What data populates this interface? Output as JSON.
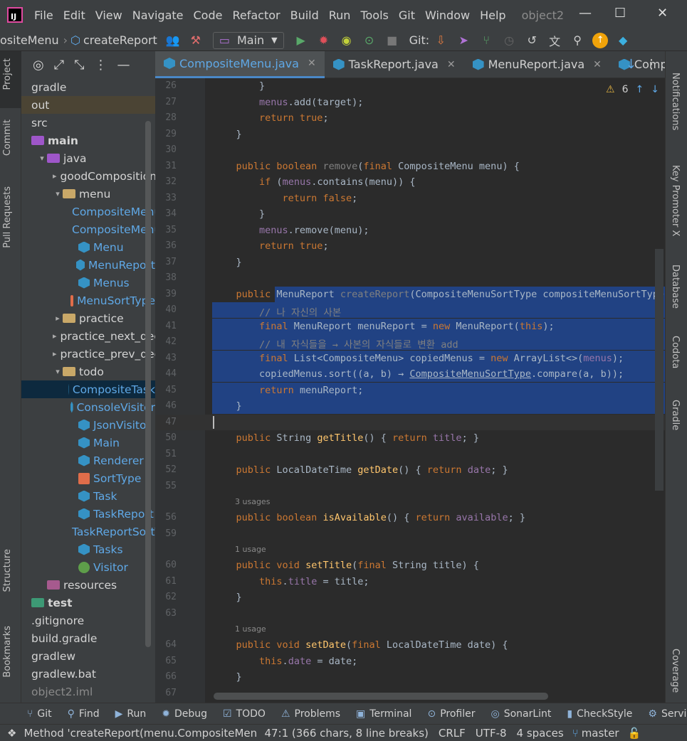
{
  "menubar": {
    "items": [
      "File",
      "Edit",
      "View",
      "Navigate",
      "Code",
      "Refactor",
      "Build",
      "Run",
      "Tools",
      "Git",
      "Window",
      "Help"
    ],
    "project": "object2"
  },
  "toolbar": {
    "breadcrumb_class": "ositeMenu",
    "breadcrumb_method": "createReport",
    "branch": "Main",
    "git_label": "Git:"
  },
  "left_strip": {
    "project": "Project",
    "commit": "Commit",
    "pull_requests": "Pull Requests",
    "structure": "Structure",
    "bookmarks": "Bookmarks"
  },
  "right_strip": {
    "notifications": "Notifications",
    "key_promoter": "Key Promoter X",
    "database": "Database",
    "codota": "Codota",
    "gradle": "Gradle",
    "coverage": "Coverage"
  },
  "project_tree": [
    {
      "label": "gradle",
      "indent": 0,
      "icon": "none",
      "arrow": ""
    },
    {
      "label": "out",
      "indent": 0,
      "icon": "none",
      "arrow": "",
      "state": "hl"
    },
    {
      "label": "src",
      "indent": 0,
      "icon": "none",
      "arrow": ""
    },
    {
      "label": "main",
      "indent": 0,
      "icon": "folder-src",
      "arrow": "",
      "bold": true
    },
    {
      "label": "java",
      "indent": 1,
      "icon": "folder-src",
      "arrow": "▾"
    },
    {
      "label": "goodComposition",
      "indent": 2,
      "icon": "folder",
      "arrow": "▸"
    },
    {
      "label": "menu",
      "indent": 2,
      "icon": "folder",
      "arrow": "▾"
    },
    {
      "label": "CompositeMenu",
      "indent": 3,
      "icon": "class",
      "arrow": "",
      "color": "#5fa8e6"
    },
    {
      "label": "CompositeMenuSortType",
      "indent": 3,
      "icon": "enum",
      "arrow": "",
      "color": "#5fa8e6"
    },
    {
      "label": "Menu",
      "indent": 3,
      "icon": "class",
      "arrow": "",
      "color": "#5fa8e6"
    },
    {
      "label": "MenuReport",
      "indent": 3,
      "icon": "class",
      "arrow": "",
      "color": "#5fa8e6"
    },
    {
      "label": "Menus",
      "indent": 3,
      "icon": "class",
      "arrow": "",
      "color": "#5fa8e6"
    },
    {
      "label": "MenuSortType",
      "indent": 3,
      "icon": "enum",
      "arrow": "",
      "color": "#5fa8e6"
    },
    {
      "label": "practice",
      "indent": 2,
      "icon": "folder",
      "arrow": "▸"
    },
    {
      "label": "practice_next_decorator",
      "indent": 2,
      "icon": "folder",
      "arrow": "▸"
    },
    {
      "label": "practice_prev_decorator",
      "indent": 2,
      "icon": "folder",
      "arrow": "▸"
    },
    {
      "label": "todo",
      "indent": 2,
      "icon": "folder",
      "arrow": "▾"
    },
    {
      "label": "CompositeTask",
      "indent": 3,
      "icon": "class",
      "arrow": "",
      "color": "#5fa8e6",
      "state": "sel"
    },
    {
      "label": "ConsoleVisitor",
      "indent": 3,
      "icon": "class",
      "arrow": "",
      "color": "#5fa8e6"
    },
    {
      "label": "JsonVisitor",
      "indent": 3,
      "icon": "class",
      "arrow": "",
      "color": "#5fa8e6"
    },
    {
      "label": "Main",
      "indent": 3,
      "icon": "class",
      "arrow": "",
      "color": "#5fa8e6"
    },
    {
      "label": "Renderer",
      "indent": 3,
      "icon": "class",
      "arrow": "",
      "color": "#5fa8e6"
    },
    {
      "label": "SortType",
      "indent": 3,
      "icon": "enum",
      "arrow": "",
      "color": "#5fa8e6"
    },
    {
      "label": "Task",
      "indent": 3,
      "icon": "class",
      "arrow": "",
      "color": "#5fa8e6"
    },
    {
      "label": "TaskReport",
      "indent": 3,
      "icon": "class",
      "arrow": "",
      "color": "#5fa8e6"
    },
    {
      "label": "TaskReportSortType",
      "indent": 3,
      "icon": "enum",
      "arrow": "",
      "color": "#5fa8e6"
    },
    {
      "label": "Tasks",
      "indent": 3,
      "icon": "class",
      "arrow": "",
      "color": "#5fa8e6"
    },
    {
      "label": "Visitor",
      "indent": 3,
      "icon": "interface",
      "arrow": "",
      "color": "#5fa8e6"
    },
    {
      "label": "resources",
      "indent": 1,
      "icon": "folder-res",
      "arrow": ""
    },
    {
      "label": "test",
      "indent": 0,
      "icon": "folder-test",
      "arrow": "",
      "bold": true
    },
    {
      "label": ".gitignore",
      "indent": 0,
      "icon": "none",
      "arrow": ""
    },
    {
      "label": "build.gradle",
      "indent": 0,
      "icon": "none",
      "arrow": ""
    },
    {
      "label": "gradlew",
      "indent": 0,
      "icon": "none",
      "arrow": ""
    },
    {
      "label": "gradlew.bat",
      "indent": 0,
      "icon": "none",
      "arrow": ""
    },
    {
      "label": "object2.iml",
      "indent": 0,
      "icon": "none",
      "arrow": "",
      "color": "#8a8a8a"
    }
  ],
  "tabs": [
    {
      "label": "CompositeMenu.java",
      "active": true
    },
    {
      "label": "TaskReport.java",
      "active": false
    },
    {
      "label": "MenuReport.java",
      "active": false
    },
    {
      "label": "Composi",
      "active": false
    }
  ],
  "warnings": "6",
  "code_lines": [
    {
      "n": "26",
      "html": "        }"
    },
    {
      "n": "27",
      "html": "        <span class=\"fld\">menus</span>.add(target);"
    },
    {
      "n": "28",
      "html": "        <span class=\"kw\">return true</span>;"
    },
    {
      "n": "29",
      "html": "    }"
    },
    {
      "n": "30",
      "html": ""
    },
    {
      "n": "31",
      "html": "    <span class=\"kw\">public boolean</span> <span class=\"gray\">remove</span>(<span class=\"kw\">final</span> CompositeMenu menu) {"
    },
    {
      "n": "32",
      "html": "        <span class=\"kw\">if</span> (<span class=\"fld\">menus</span>.contains(menu)) {"
    },
    {
      "n": "33",
      "html": "            <span class=\"kw\">return false</span>;"
    },
    {
      "n": "34",
      "html": "        }"
    },
    {
      "n": "35",
      "html": "        <span class=\"fld\">menus</span>.remove(menu);"
    },
    {
      "n": "36",
      "html": "        <span class=\"kw\">return true</span>;"
    },
    {
      "n": "37",
      "html": "    }"
    },
    {
      "n": "38",
      "html": ""
    },
    {
      "n": "39",
      "html": "    <span class=\"kw\">public</span> MenuReport <span class=\"gray\">createReport</span>(CompositeMenuSortType compositeMenuSortType) {",
      "sel": "partial"
    },
    {
      "n": "40",
      "html": "        <span class=\"cmt\">// 나 자신의 사본</span>",
      "sel": "full"
    },
    {
      "n": "41",
      "html": "        <span class=\"kw\">final</span> MenuReport menuReport = <span class=\"kw\">new</span> MenuReport(<span class=\"kw\">this</span>);",
      "sel": "full"
    },
    {
      "n": "42",
      "html": "        <span class=\"cmt\">// 내 자식들을 → 사본의 자식들로 변환 add</span>",
      "sel": "full"
    },
    {
      "n": "43",
      "html": "        <span class=\"kw\">final</span> List&lt;CompositeMenu&gt; copiedMenus = <span class=\"kw\">new</span> ArrayList&lt;&gt;(<span class=\"fld\">menus</span>);",
      "sel": "full"
    },
    {
      "n": "44",
      "html": "        copiedMenus.sort((a, b) → <u>CompositeMenuSortType</u>.compare(a, b));",
      "sel": "full"
    },
    {
      "n": "45",
      "html": "        <span class=\"kw\">return</span> menuReport;",
      "sel": "full"
    },
    {
      "n": "46",
      "html": "    }",
      "sel": "full"
    },
    {
      "n": "47",
      "html": "",
      "cursor": true
    },
    {
      "n": "50",
      "html": "    <span class=\"kw\">public</span> String <span class=\"fn\">getTitle</span>() { <span class=\"kw\">return</span> <span class=\"fld\">title</span>; }"
    },
    {
      "n": "51",
      "html": ""
    },
    {
      "n": "52",
      "html": "    <span class=\"kw\">public</span> LocalDateTime <span class=\"fn\">getDate</span>() { <span class=\"kw\">return</span> <span class=\"fld\">date</span>; }"
    },
    {
      "n": "55",
      "html": ""
    },
    {
      "n": "56",
      "html": "    <span class=\"kw\">public boolean</span> <span class=\"fn\">isAvailable</span>() { <span class=\"kw\">return</span> <span class=\"fld\">available</span>; }",
      "usage": "3 usages"
    },
    {
      "n": "59",
      "html": ""
    },
    {
      "n": "60",
      "html": "    <span class=\"kw\">public void</span> <span class=\"fn\">setTitle</span>(<span class=\"kw\">final</span> String title) {",
      "usage": "1 usage"
    },
    {
      "n": "61",
      "html": "        <span class=\"kw\">this</span>.<span class=\"fld\">title</span> = title;"
    },
    {
      "n": "62",
      "html": "    }"
    },
    {
      "n": "63",
      "html": ""
    },
    {
      "n": "64",
      "html": "    <span class=\"kw\">public void</span> <span class=\"fn\">setDate</span>(<span class=\"kw\">final</span> LocalDateTime date) {",
      "usage": "1 usage"
    },
    {
      "n": "65",
      "html": "        <span class=\"kw\">this</span>.<span class=\"fld\">date</span> = date;"
    },
    {
      "n": "66",
      "html": "    }"
    },
    {
      "n": "67",
      "html": ""
    }
  ],
  "bottom_tools": [
    "Git",
    "Find",
    "Run",
    "Debug",
    "TODO",
    "Problems",
    "Terminal",
    "Profiler",
    "SonarLint",
    "CheckStyle",
    "Servic"
  ],
  "status": {
    "message": "Method 'createReport(menu.CompositeMen",
    "position": "47:1 (366 chars, 8 line breaks)",
    "line_sep": "CRLF",
    "encoding": "UTF-8",
    "indent": "4 spaces",
    "branch": "master"
  },
  "colors": {
    "selection": "#214283",
    "keyword": "#cc7832",
    "method": "#ffc66d",
    "field": "#9876aa",
    "comment": "#808080"
  }
}
